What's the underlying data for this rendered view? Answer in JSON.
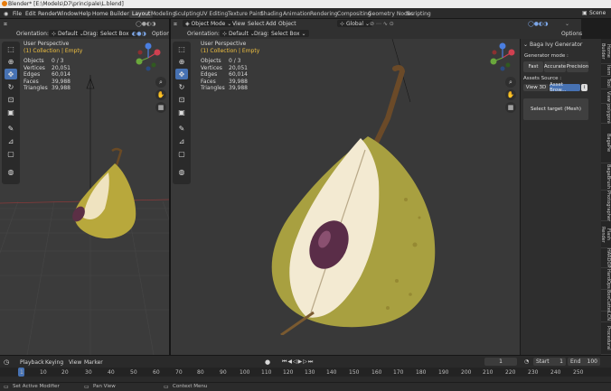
{
  "title_bar": {
    "text": "Blender* [E:\\Models\\D7\\principale\\L.blend]"
  },
  "menus": [
    "File",
    "Edit",
    "Render",
    "Window",
    "Help",
    "Home Builder"
  ],
  "workspaces": [
    "Layout",
    "Modeling",
    "Sculpting",
    "UV Editing",
    "Texture Paint",
    "Shading",
    "Animation",
    "Rendering",
    "Compositing",
    "Geometry Nodes",
    "Scripting"
  ],
  "active_workspace": "Layout",
  "scene_label": "Scene",
  "left_viewport": {
    "header": {
      "orientation_label": "Orientation:",
      "orientation_value": "Default",
      "drag_label": "Drag:",
      "drag_value": "Select Box",
      "options": "Options"
    },
    "overlay": {
      "view_name": "User Perspective",
      "collection": "(1) Collection | Empty",
      "stats": [
        {
          "label": "Objects",
          "value": "0 / 3"
        },
        {
          "label": "Vertices",
          "value": "20,051"
        },
        {
          "label": "Edges",
          "value": "60,014"
        },
        {
          "label": "Faces",
          "value": "39,988"
        },
        {
          "label": "Triangles",
          "value": "39,988"
        }
      ]
    }
  },
  "right_viewport": {
    "header": {
      "mode": "Object Mode",
      "view": "View",
      "select": "Select",
      "add": "Add",
      "object": "Object",
      "orientation_label": "Orientation:",
      "orientation_value": "Default",
      "drag_label": "Drag:",
      "drag_value": "Select Box",
      "transform": "Global",
      "options": "Options"
    },
    "overlay": {
      "view_name": "User Perspective",
      "collection": "(1) Collection | Empty",
      "stats": [
        {
          "label": "Objects",
          "value": "0 / 3"
        },
        {
          "label": "Vertices",
          "value": "20,051"
        },
        {
          "label": "Edges",
          "value": "60,014"
        },
        {
          "label": "Faces",
          "value": "39,988"
        },
        {
          "label": "Triangles",
          "value": "39,988"
        }
      ]
    }
  },
  "n_panel": {
    "title": "Baga Ivy Generator",
    "generator_mode_label": "Generator mode :",
    "modes": [
      "Fast",
      "Accurate",
      "Precision"
    ],
    "assets_source_label": "Assets Source :",
    "view3d": "View 3D",
    "asset_browser": "Asset Brow...",
    "select_target": "Select target (Mesh)"
  },
  "side_tabs": [
    "Home Builder",
    "Item",
    "Tool",
    "View",
    "polygoniq",
    "BagaPie",
    "BagaBrush",
    "Photographer",
    "Flash Render",
    "HARDOPS",
    "HardOps",
    "BoxCutter",
    "LCN",
    "Procedural"
  ],
  "timeline": {
    "playback": "Playback",
    "keying": "Keying",
    "view": "View",
    "marker": "Marker",
    "current_frame": "1",
    "start_label": "Start",
    "start": "1",
    "end_label": "End",
    "end": "100",
    "ticks": [
      "1",
      "10",
      "20",
      "30",
      "40",
      "50",
      "60",
      "70",
      "80",
      "90",
      "100",
      "110",
      "120",
      "130",
      "140",
      "150",
      "160",
      "170",
      "180",
      "190",
      "200",
      "210",
      "220",
      "230",
      "240",
      "250"
    ]
  },
  "status": {
    "left": "Set Active Modifier",
    "middle": "Pan View",
    "right": "Context Menu"
  }
}
